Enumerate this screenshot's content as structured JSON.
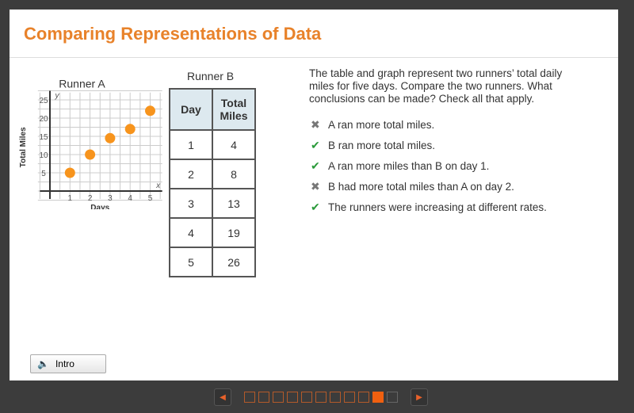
{
  "title": "Comparing Representations of Data",
  "chart_data": {
    "type": "scatter",
    "title": "Runner A",
    "xlabel": "Days",
    "ylabel": "Total Miles",
    "xlim": [
      0,
      5
    ],
    "ylim": [
      0,
      25
    ],
    "x_ticks": [
      1,
      2,
      3,
      4,
      5
    ],
    "y_ticks": [
      5,
      10,
      15,
      20,
      25
    ],
    "x_axis_var": "x",
    "y_axis_var": "y",
    "grid": true,
    "color": "#f7941d",
    "x": [
      1,
      2,
      3,
      4,
      5
    ],
    "y": [
      5,
      10,
      14.5,
      17,
      22
    ]
  },
  "table": {
    "title": "Runner B",
    "headers": [
      "Day",
      "Total Miles"
    ],
    "rows": [
      [
        "1",
        "4"
      ],
      [
        "2",
        "8"
      ],
      [
        "3",
        "13"
      ],
      [
        "4",
        "19"
      ],
      [
        "5",
        "26"
      ]
    ]
  },
  "question": "The table and graph represent two runners’ total daily miles for five days. Compare the two runners. What conclusions can be made? Check all that apply.",
  "options": [
    {
      "label": "A ran more total miles.",
      "mark": "x-icon"
    },
    {
      "label": "B ran more total miles.",
      "mark": "check-icon"
    },
    {
      "label": "A ran more miles than B on day 1.",
      "mark": "check-icon"
    },
    {
      "label": "B had more total miles than A on day 2.",
      "mark": "x-icon"
    },
    {
      "label": "The runners were increasing at different rates.",
      "mark": "check-icon"
    }
  ],
  "intro_label": "Intro",
  "pager": {
    "total": 11,
    "current": 10
  }
}
